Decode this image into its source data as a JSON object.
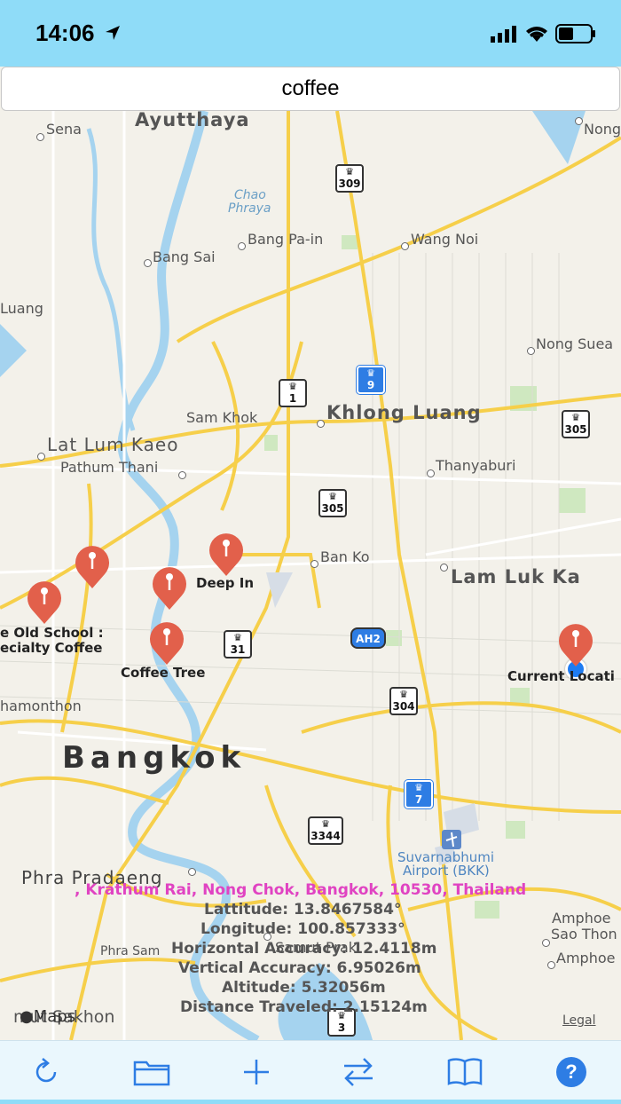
{
  "status_bar": {
    "time": "14:06",
    "icons": [
      "location-arrow-icon",
      "cellular-signal-icon",
      "wifi-icon",
      "battery-icon"
    ]
  },
  "search": {
    "value": "coffee"
  },
  "map": {
    "places": {
      "sena": "Sena",
      "ayutthaya": "Ayutthaya",
      "nong": "Nong",
      "chao_phraya_1": "Chao",
      "chao_phraya_2": "Phraya",
      "bang_pa_in": "Bang Pa-in",
      "wang_noi": "Wang Noi",
      "bang_sai": "Bang Sai",
      "luang": "Luang",
      "nong_suea": "Nong Suea",
      "sam_khok": "Sam Khok",
      "khlong_luang": "Khlong Luang",
      "lat_lum_kaeo": "Lat Lum Kaeo",
      "pathum_thani": "Pathum Thani",
      "thanyaburi": "Thanyaburi",
      "ban_ko": "Ban Ko",
      "lam_luk_ka": "Lam Luk Ka",
      "thamonthon": "hamonthon",
      "bangkok": "Bangkok",
      "suvarnabhumi_1": "Suvarnabhumi",
      "suvarnabhumi_2": "Airport (BKK)",
      "phra_pradaeng": "Phra Pradaeng",
      "amphoe_sao_1": "Amphoe",
      "amphoe_sao_2": "Sao Thon",
      "amphoe_3": "Amphoe",
      "phra_samut": "Phra Sam",
      "samut_prakan": "Samut Prak",
      "samut_sakhon": "mut Sakhon"
    },
    "shields": [
      "309",
      "9",
      "1",
      "305",
      "305",
      "31",
      "AH2",
      "304",
      "7",
      "3344",
      "3"
    ],
    "pins": [
      {
        "name": "Deep In"
      },
      {
        "name": "e Old School :"
      },
      {
        "name": "ecialty Coffee"
      },
      {
        "name": "Coffee Tree"
      },
      {
        "name": "Current Locati"
      }
    ],
    "info": {
      "address": ", Krathum Rai, Nong Chok, Bangkok, 10530, Thailand",
      "latitude": "Lattitude: 13.8467584°",
      "longitude": "Longitude: 100.857333°",
      "horizontal_accuracy": "Horizontal Accuracy: 12.4118m",
      "vertical_accuracy": "Vertical Accuracy: 6.95026m",
      "altitude": "Altitude: 5.32056m",
      "distance": "Distance Traveled: 2.15124m"
    },
    "maps_logo": "Maps",
    "legal": "Legal"
  },
  "toolbar": {
    "buttons": [
      "refresh-icon",
      "folder-icon",
      "plus-icon",
      "swap-arrows-icon",
      "book-icon",
      "help-icon"
    ],
    "help_label": "?",
    "accent": "#2e7de4"
  }
}
